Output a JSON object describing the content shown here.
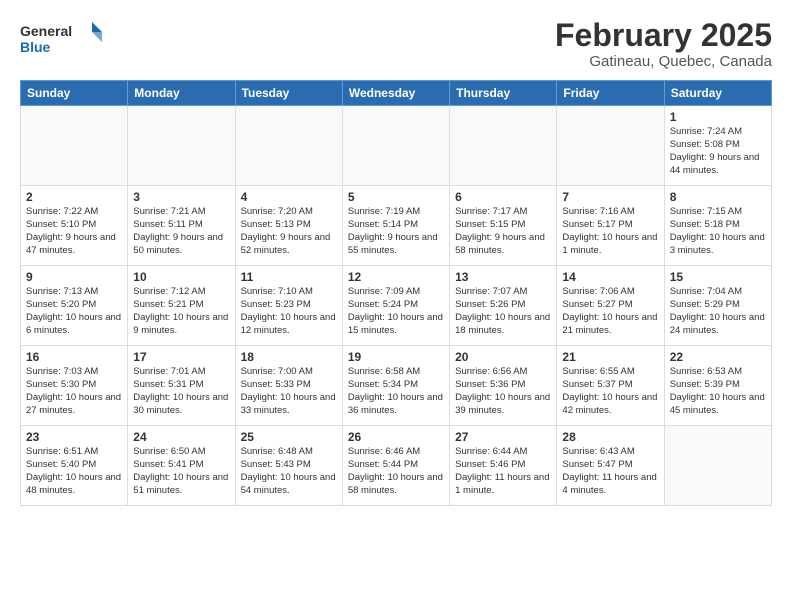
{
  "header": {
    "logo_general": "General",
    "logo_blue": "Blue",
    "month_title": "February 2025",
    "location": "Gatineau, Quebec, Canada"
  },
  "weekdays": [
    "Sunday",
    "Monday",
    "Tuesday",
    "Wednesday",
    "Thursday",
    "Friday",
    "Saturday"
  ],
  "weeks": [
    {
      "shade": false,
      "days": [
        {
          "num": "",
          "info": ""
        },
        {
          "num": "",
          "info": ""
        },
        {
          "num": "",
          "info": ""
        },
        {
          "num": "",
          "info": ""
        },
        {
          "num": "",
          "info": ""
        },
        {
          "num": "",
          "info": ""
        },
        {
          "num": "1",
          "info": "Sunrise: 7:24 AM\nSunset: 5:08 PM\nDaylight: 9 hours and 44 minutes."
        }
      ]
    },
    {
      "shade": false,
      "days": [
        {
          "num": "2",
          "info": "Sunrise: 7:22 AM\nSunset: 5:10 PM\nDaylight: 9 hours and 47 minutes."
        },
        {
          "num": "3",
          "info": "Sunrise: 7:21 AM\nSunset: 5:11 PM\nDaylight: 9 hours and 50 minutes."
        },
        {
          "num": "4",
          "info": "Sunrise: 7:20 AM\nSunset: 5:13 PM\nDaylight: 9 hours and 52 minutes."
        },
        {
          "num": "5",
          "info": "Sunrise: 7:19 AM\nSunset: 5:14 PM\nDaylight: 9 hours and 55 minutes."
        },
        {
          "num": "6",
          "info": "Sunrise: 7:17 AM\nSunset: 5:15 PM\nDaylight: 9 hours and 58 minutes."
        },
        {
          "num": "7",
          "info": "Sunrise: 7:16 AM\nSunset: 5:17 PM\nDaylight: 10 hours and 1 minute."
        },
        {
          "num": "8",
          "info": "Sunrise: 7:15 AM\nSunset: 5:18 PM\nDaylight: 10 hours and 3 minutes."
        }
      ]
    },
    {
      "shade": true,
      "days": [
        {
          "num": "9",
          "info": "Sunrise: 7:13 AM\nSunset: 5:20 PM\nDaylight: 10 hours and 6 minutes."
        },
        {
          "num": "10",
          "info": "Sunrise: 7:12 AM\nSunset: 5:21 PM\nDaylight: 10 hours and 9 minutes."
        },
        {
          "num": "11",
          "info": "Sunrise: 7:10 AM\nSunset: 5:23 PM\nDaylight: 10 hours and 12 minutes."
        },
        {
          "num": "12",
          "info": "Sunrise: 7:09 AM\nSunset: 5:24 PM\nDaylight: 10 hours and 15 minutes."
        },
        {
          "num": "13",
          "info": "Sunrise: 7:07 AM\nSunset: 5:26 PM\nDaylight: 10 hours and 18 minutes."
        },
        {
          "num": "14",
          "info": "Sunrise: 7:06 AM\nSunset: 5:27 PM\nDaylight: 10 hours and 21 minutes."
        },
        {
          "num": "15",
          "info": "Sunrise: 7:04 AM\nSunset: 5:29 PM\nDaylight: 10 hours and 24 minutes."
        }
      ]
    },
    {
      "shade": false,
      "days": [
        {
          "num": "16",
          "info": "Sunrise: 7:03 AM\nSunset: 5:30 PM\nDaylight: 10 hours and 27 minutes."
        },
        {
          "num": "17",
          "info": "Sunrise: 7:01 AM\nSunset: 5:31 PM\nDaylight: 10 hours and 30 minutes."
        },
        {
          "num": "18",
          "info": "Sunrise: 7:00 AM\nSunset: 5:33 PM\nDaylight: 10 hours and 33 minutes."
        },
        {
          "num": "19",
          "info": "Sunrise: 6:58 AM\nSunset: 5:34 PM\nDaylight: 10 hours and 36 minutes."
        },
        {
          "num": "20",
          "info": "Sunrise: 6:56 AM\nSunset: 5:36 PM\nDaylight: 10 hours and 39 minutes."
        },
        {
          "num": "21",
          "info": "Sunrise: 6:55 AM\nSunset: 5:37 PM\nDaylight: 10 hours and 42 minutes."
        },
        {
          "num": "22",
          "info": "Sunrise: 6:53 AM\nSunset: 5:39 PM\nDaylight: 10 hours and 45 minutes."
        }
      ]
    },
    {
      "shade": true,
      "days": [
        {
          "num": "23",
          "info": "Sunrise: 6:51 AM\nSunset: 5:40 PM\nDaylight: 10 hours and 48 minutes."
        },
        {
          "num": "24",
          "info": "Sunrise: 6:50 AM\nSunset: 5:41 PM\nDaylight: 10 hours and 51 minutes."
        },
        {
          "num": "25",
          "info": "Sunrise: 6:48 AM\nSunset: 5:43 PM\nDaylight: 10 hours and 54 minutes."
        },
        {
          "num": "26",
          "info": "Sunrise: 6:46 AM\nSunset: 5:44 PM\nDaylight: 10 hours and 58 minutes."
        },
        {
          "num": "27",
          "info": "Sunrise: 6:44 AM\nSunset: 5:46 PM\nDaylight: 11 hours and 1 minute."
        },
        {
          "num": "28",
          "info": "Sunrise: 6:43 AM\nSunset: 5:47 PM\nDaylight: 11 hours and 4 minutes."
        },
        {
          "num": "",
          "info": ""
        }
      ]
    }
  ]
}
